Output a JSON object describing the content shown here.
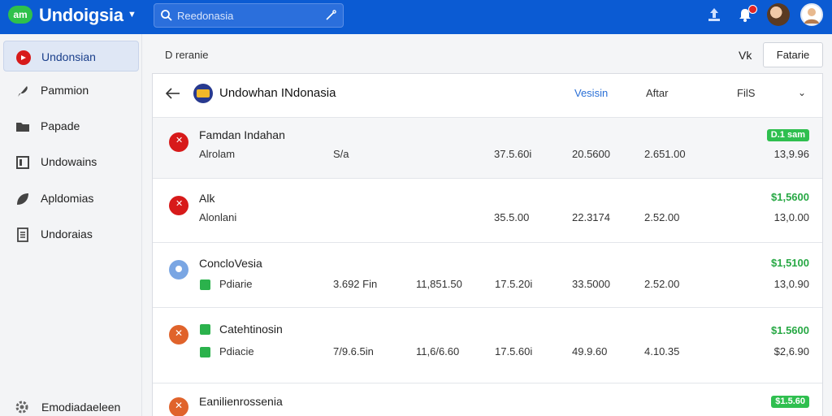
{
  "header": {
    "logo_text": "am",
    "brand": "Undoigsia",
    "search": {
      "placeholder": "Reedonasia"
    }
  },
  "sidebar": {
    "items": [
      {
        "label": "Undonsian",
        "icon": "flag-icon",
        "active": true
      },
      {
        "label": "Pammion",
        "icon": "feather-icon"
      },
      {
        "label": "Papade",
        "icon": "folder-icon"
      },
      {
        "label": "Undowains",
        "icon": "book-icon"
      },
      {
        "label": "Apldomias",
        "icon": "leaf-icon"
      },
      {
        "label": "Undoraias",
        "icon": "document-icon"
      }
    ],
    "footer": {
      "label": "Emodiadaeleen",
      "icon": "gear-icon"
    }
  },
  "toolbar": {
    "breadcrumb": "D reranie",
    "vk_label": "Vk",
    "action_button": "Fatarie"
  },
  "panel": {
    "title": "Undowhan INdonasia",
    "columns": {
      "link": "Vesisin",
      "col2": "Aftar",
      "col3": "FilS"
    },
    "rows": [
      {
        "name": "Famdan Indahan",
        "sub": "Alrolam",
        "c1": "S/a",
        "c2": "",
        "c3": "37.5.60i",
        "c4": "20.5600",
        "c5": "2.651.00",
        "top_amount": "D.1 sam",
        "top_style": "badge",
        "bottom_amount": "13,9.96",
        "icon_color": "#d71a1a"
      },
      {
        "name": "Alk",
        "sub": "Alonlani",
        "c1": "",
        "c2": "",
        "c3": "35.5.00",
        "c4": "22.3174",
        "c5": "2.52.00",
        "top_amount": "$1,5600",
        "top_style": "text",
        "bottom_amount": "13,0.00",
        "icon_color": "#d71a1a"
      },
      {
        "name": "ConcloVesia",
        "sub": "Pdiarie",
        "c1": "3.692 Fin",
        "c2": "11,851.50",
        "c3": "17.5.20i",
        "c4": "33.5000",
        "c5": "2.52.00",
        "top_amount": "$1,5100",
        "top_style": "text",
        "bottom_amount": "13,0.90",
        "icon_color": "#7aa6e3"
      },
      {
        "name": "Catehtinosin",
        "sub": "Pdiacie",
        "c1": "7/9.6.5in",
        "c2": "11,6/6.60",
        "c3": "17.5.60i",
        "c4": "49.9.60",
        "c5": "4.10.35",
        "top_amount": "$1.5600",
        "top_style": "text",
        "bottom_amount": "$2,6.90",
        "icon_color": "#e0632b"
      },
      {
        "name": "Eanilienrossenia",
        "sub": "",
        "c1": "",
        "c2": "",
        "c3": "",
        "c4": "",
        "c5": "",
        "top_amount": "$1.5.60",
        "top_style": "badge",
        "bottom_amount": "",
        "icon_color": "#e0632b"
      }
    ]
  },
  "colors": {
    "topbar": "#0b5bd3",
    "accent": "#2a6fd6",
    "positive": "#27a844"
  }
}
